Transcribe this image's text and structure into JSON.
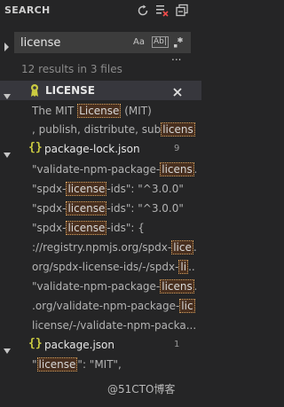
{
  "panel": {
    "title": "SEARCH"
  },
  "header_icons": [
    "refresh-icon",
    "clear-results-icon",
    "collapse-all-icon"
  ],
  "search": {
    "value": "license",
    "option_case": "Aa",
    "option_word": "Ab|",
    "option_regex_icon": "regex-icon",
    "more_icon": "..."
  },
  "summary": "12 results in 3 files",
  "files": [
    {
      "name": "LICENSE",
      "icon": "license-icon",
      "close_label": "×",
      "matches": [
        {
          "pre": "The MIT ",
          "hit": "License",
          "post": " (MIT)"
        },
        {
          "pre": ", publish, distribute, sub",
          "hit": "licens",
          "post": "..."
        }
      ]
    },
    {
      "name": "package-lock.json",
      "icon": "{}",
      "count": "9",
      "matches": [
        {
          "pre": "\"validate-npm-package-",
          "hit": "licens",
          "post": "..."
        },
        {
          "pre": "\"spdx-",
          "hit": "license",
          "post": "-ids\": \"^3.0.0\""
        },
        {
          "pre": "\"spdx-",
          "hit": "license",
          "post": "-ids\": \"^3.0.0\""
        },
        {
          "pre": "\"spdx-",
          "hit": "license",
          "post": "-ids\": {"
        },
        {
          "pre": "://registry.npmjs.org/spdx-",
          "hit": "lice",
          "post": "..."
        },
        {
          "pre": "org/spdx-license-ids/-/spdx-",
          "hit": "li",
          "post": "..."
        },
        {
          "pre": "\"validate-npm-package-",
          "hit": "licens",
          "post": "..."
        },
        {
          "pre": ".org/validate-npm-package-",
          "hit": "lic",
          "post": "..."
        },
        {
          "pre": "license/-/validate-npm-packa...",
          "hit": "",
          "post": ""
        }
      ]
    },
    {
      "name": "package.json",
      "icon": "{}",
      "count": "1",
      "matches": [
        {
          "pre": "\"",
          "hit": "license",
          "post": "\": \"MIT\","
        }
      ]
    }
  ],
  "watermark": "@51CTO博客",
  "colors": {
    "background": "#252526",
    "input_bg": "#3c3c3c",
    "match_highlight_border": "#d0a060",
    "json_icon": "#cbcb41",
    "license_icon": "#cbcb41"
  }
}
